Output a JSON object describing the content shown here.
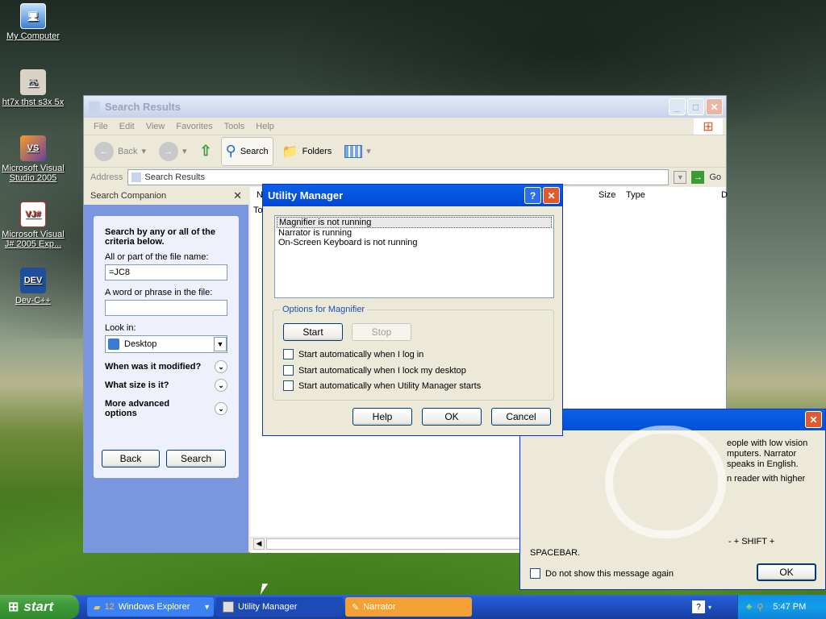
{
  "desktop": {
    "icons": [
      {
        "label": "My Computer",
        "icon": "computer-icon"
      },
      {
        "label": "ht7x thst  s3x 5x",
        "icon": "raccoon-shortcut-icon"
      },
      {
        "label": "Microsoft Visual Studio 2005",
        "icon": "visual-studio-icon"
      },
      {
        "label": "Microsoft Visual J# 2005 Exp...",
        "icon": "vjsharp-icon"
      },
      {
        "label": "Dev-C++",
        "icon": "devcpp-icon"
      }
    ]
  },
  "explorer": {
    "title": "Search Results",
    "menu": [
      "File",
      "Edit",
      "View",
      "Favorites",
      "Tools",
      "Help"
    ],
    "toolbar": {
      "back": "Back",
      "search": "Search",
      "folders": "Folders"
    },
    "address_label": "Address",
    "address_value": "Search Results",
    "go_label": "Go",
    "companion_title": "Search Companion",
    "criteria_heading": "Search by any or all of the criteria below.",
    "filename_label": "All or part of the file name:",
    "filename_value": "=JC8",
    "phrase_label": "A word or phrase in the file:",
    "phrase_value": "",
    "lookin_label": "Look in:",
    "lookin_value": "Desktop",
    "modified_label": "When was it modified?",
    "size_label": "What size is it?",
    "advanced_label": "More advanced options",
    "back_button": "Back",
    "search_button": "Search",
    "columns": [
      "N",
      "Size",
      "Type",
      "D"
    ],
    "results_text": "To"
  },
  "utility": {
    "title": "Utility Manager",
    "list": [
      "Magnifier is not running",
      "Narrator is running",
      "On-Screen Keyboard is not running"
    ],
    "group_label": "Options for Magnifier",
    "start_button": "Start",
    "stop_button": "Stop",
    "checks": [
      "Start automatically when I log in",
      "Start automatically when I lock my desktop",
      "Start automatically when Utility Manager starts"
    ],
    "help_button": "Help",
    "ok_button": "OK",
    "cancel_button": "Cancel"
  },
  "narrator_dialog": {
    "line1": "eople with low vision",
    "line2": "mputers. Narrator",
    "line3": "speaks in English.",
    "line4": "n reader with higher",
    "line5": "- + SHIFT +",
    "line6": "SPACEBAR.",
    "checkbox": "Do not show this message again",
    "ok_button": "OK"
  },
  "taskbar": {
    "start": "start",
    "tasks": [
      {
        "count": "12",
        "label": "Windows Explorer"
      },
      {
        "label": "Utility Manager"
      },
      {
        "label": "Narrator"
      }
    ],
    "clock": "5:47 PM"
  },
  "colors": {
    "xp_blue": "#0a5ee4",
    "start_green": "#3c9a37",
    "narrator_orange": "#f4a035"
  }
}
